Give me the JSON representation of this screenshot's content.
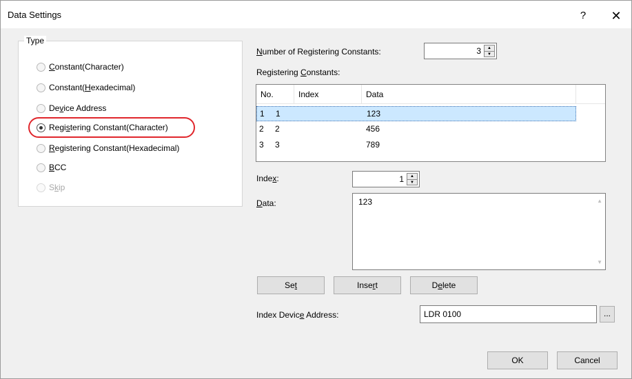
{
  "window": {
    "title": "Data Settings",
    "help_label": "?",
    "close_label": "✕"
  },
  "type_group": {
    "label": "Type",
    "options": [
      {
        "pre": "",
        "u": "C",
        "post": "onstant(Character)",
        "selected": false,
        "disabled": false
      },
      {
        "pre": "Constant(",
        "u": "H",
        "post": "exadecimal)",
        "selected": false,
        "disabled": false
      },
      {
        "pre": "De",
        "u": "v",
        "post": "ice Address",
        "selected": false,
        "disabled": false
      },
      {
        "pre": "Regi",
        "u": "s",
        "post": "tering Constant(Character)",
        "selected": true,
        "disabled": false
      },
      {
        "pre": "",
        "u": "R",
        "post": "egistering Constant(Hexadecimal)",
        "selected": false,
        "disabled": false
      },
      {
        "pre": "",
        "u": "B",
        "post": "CC",
        "selected": false,
        "disabled": false
      },
      {
        "pre": "S",
        "u": "k",
        "post": "ip",
        "selected": false,
        "disabled": true
      }
    ]
  },
  "num_constants": {
    "label_u": "N",
    "label_rest": "umber of Registering Constants:",
    "value": "3"
  },
  "registering_constants": {
    "label_pre": "Registering ",
    "label_u": "C",
    "label_post": "onstants:",
    "columns": [
      "No.",
      "Index",
      "Data"
    ],
    "rows": [
      {
        "no": "1",
        "index": "1",
        "data": "123",
        "selected": true
      },
      {
        "no": "2",
        "index": "2",
        "data": "456",
        "selected": false
      },
      {
        "no": "3",
        "index": "3",
        "data": "789",
        "selected": false
      }
    ]
  },
  "index": {
    "label_pre": "Inde",
    "label_u": "x",
    "label_post": ":",
    "value": "1"
  },
  "data_field": {
    "label_u": "D",
    "label_post": "ata:",
    "value": "123"
  },
  "buttons": {
    "set": {
      "pre": "Se",
      "u": "t",
      "post": ""
    },
    "insert": {
      "pre": "Inse",
      "u": "r",
      "post": "t"
    },
    "delete": {
      "pre": "D",
      "u": "e",
      "post": "lete"
    }
  },
  "index_device": {
    "label_pre": "Index Devic",
    "label_u": "e",
    "label_post": " Address:",
    "value": "LDR 0100",
    "browse_label": "..."
  },
  "footer": {
    "ok_label": "OK",
    "cancel_label": "Cancel"
  },
  "colors": {
    "highlight_ring": "#e0252b",
    "selection": "#cce8ff"
  }
}
